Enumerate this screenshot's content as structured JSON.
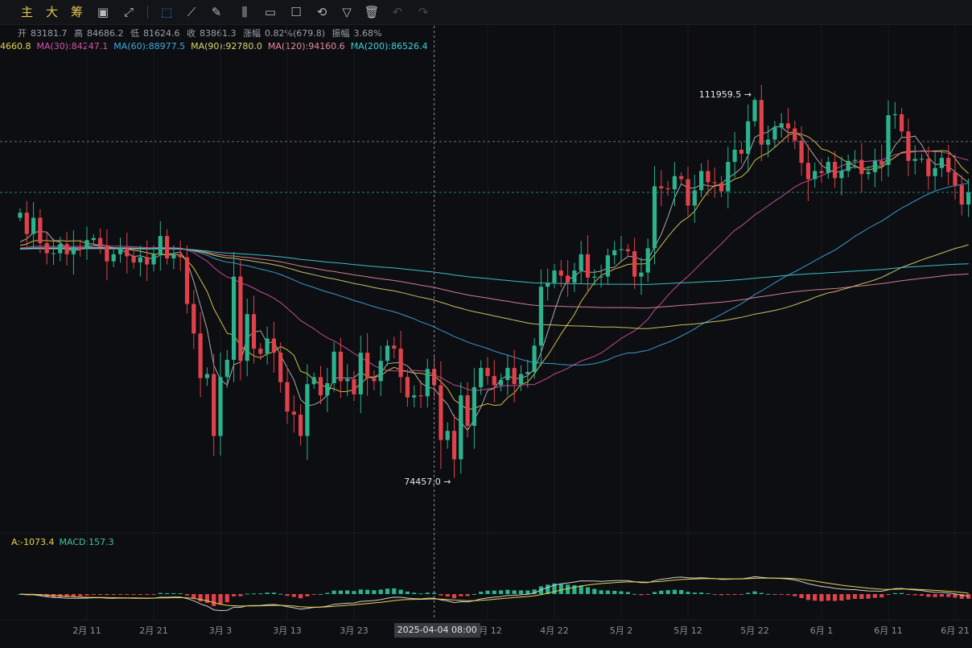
{
  "toolbar": {
    "labels": [
      "主",
      "大",
      "筹"
    ],
    "icons": [
      "chart-type-icon",
      "indicator-icon",
      "select-tool-icon",
      "ruler-icon",
      "pen-icon",
      "candle-icon",
      "box-icon",
      "note-icon",
      "magnet-icon",
      "filter-icon",
      "trash-icon",
      "undo-icon",
      "redo-icon"
    ]
  },
  "ohlc": {
    "open_label": "开",
    "open": "83181.7",
    "high_label": "高",
    "high": "84686.2",
    "low_label": "低",
    "low": "81624.6",
    "close_label": "收",
    "close": "83861.3",
    "change_label": "涨幅",
    "change": "0.82%(679.8)",
    "amplitude_label": "振幅",
    "amplitude": "3.68%"
  },
  "ma_legend": [
    {
      "text": "4660.8",
      "color": "#e6d44a"
    },
    {
      "text": "MA(30):84247.1",
      "color": "#d653a8"
    },
    {
      "text": "MA(60):88977.5",
      "color": "#3fa9e0"
    },
    {
      "text": "MA(90):92780.0",
      "color": "#d9d46a"
    },
    {
      "text": "MA(120):94160.6",
      "color": "#e58a9a"
    },
    {
      "text": "MA(200):86526.4",
      "color": "#3fd0d8"
    }
  ],
  "macd_legend": [
    {
      "text": "A:-1073.4",
      "color": "#e6d44a"
    },
    {
      "text": "MACD:157.3",
      "color": "#3fc49a"
    }
  ],
  "colors": {
    "up": "#2bb38e",
    "down": "#e0424b",
    "bg": "#0d0e12"
  },
  "crosshair_label": "2025-04-04 08:00",
  "chart_data": {
    "type": "candlestick",
    "y_range": [
      70000,
      116000
    ],
    "annotations": [
      {
        "date": "2025-05-22",
        "price": 111959.5,
        "text": "111959.5 →"
      },
      {
        "date": "2025-04-07",
        "price": 74457.0,
        "text": "74457.0 →"
      }
    ],
    "x_ticks": [
      "2月 11",
      "2月 21",
      "3月 3",
      "3月 13",
      "3月 23",
      "4月 12",
      "4月 22",
      "5月 2",
      "5月 12",
      "5月 22",
      "6月 1",
      "6月 11",
      "6月 21"
    ],
    "start_date": "2025-02-01",
    "closes": [
      100600,
      98500,
      100100,
      97600,
      96600,
      96600,
      97500,
      96500,
      97200,
      97000,
      97900,
      98100,
      97400,
      95800,
      96500,
      97100,
      96300,
      95700,
      96200,
      95500,
      96500,
      98300,
      96100,
      96500,
      96200,
      91600,
      88700,
      84300,
      84700,
      78600,
      84400,
      86100,
      94300,
      86000,
      90600,
      87200,
      86700,
      88200,
      86800,
      83900,
      81000,
      80700,
      78600,
      83700,
      84400,
      82600,
      83800,
      86900,
      84000,
      84200,
      82700,
      86800,
      84300,
      84000,
      86000,
      87500,
      87200,
      84400,
      82400,
      82600,
      82500,
      85200,
      83600,
      78200,
      79100,
      76300,
      82600,
      79600,
      83400,
      85300,
      84500,
      83600,
      84100,
      85300,
      83700,
      84700,
      84900,
      87500,
      93300,
      93700,
      94900,
      94400,
      93700,
      94900,
      96500,
      94200,
      94300,
      94300,
      96400,
      96900,
      97000,
      96800,
      94300,
      94700,
      97100,
      103200,
      103000,
      102900,
      104200,
      103900,
      101300,
      102800,
      104700,
      103600,
      103500,
      102700,
      105600,
      106800,
      106400,
      109600,
      111700,
      107300,
      107800,
      109000,
      109400,
      108900,
      107700,
      105500,
      103900,
      104700,
      104500,
      105600,
      104000,
      104700,
      105700,
      105800,
      104400,
      104600,
      105700,
      105300,
      110200,
      110300,
      108600,
      105700,
      105900,
      105900,
      104200,
      105000,
      106000,
      104600,
      103300,
      101400,
      102600
    ],
    "macd_series": [
      {
        "name": "DIF",
        "color": "#cfcfcf"
      },
      {
        "name": "DEA",
        "color": "#e6d44a"
      }
    ]
  }
}
